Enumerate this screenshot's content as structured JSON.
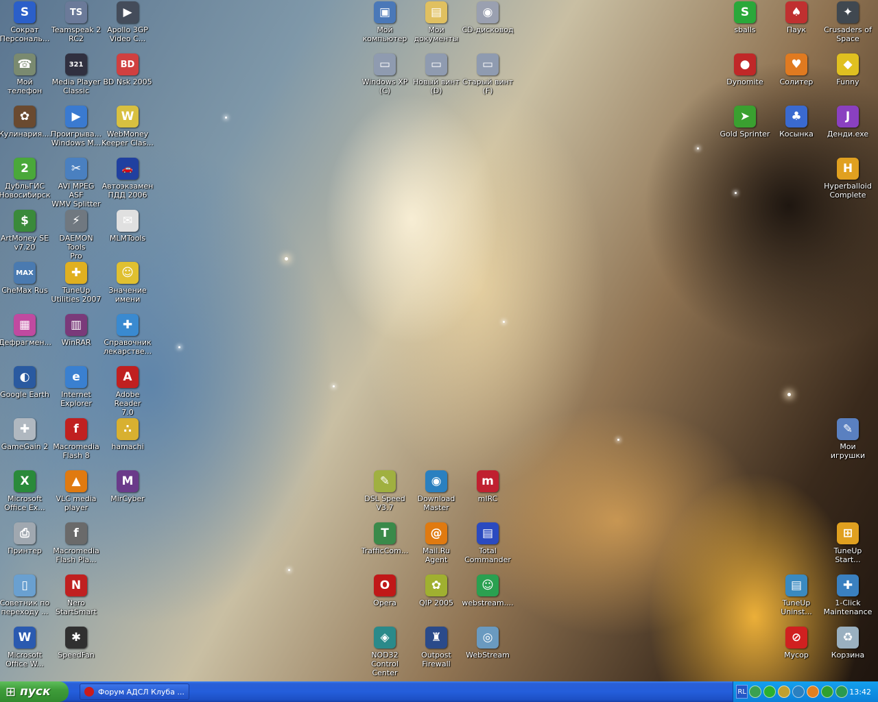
{
  "desktop": {
    "icons": [
      {
        "label": "Сократ\nПерсональ...",
        "color": "#2b5fc9",
        "glyph": "S"
      },
      {
        "label": "Teamspeak 2\nRC2",
        "color": "#6b7a99",
        "glyph": "TS"
      },
      {
        "label": "Apollo 3GP\nVideo C...",
        "color": "#444c5a",
        "glyph": "▶"
      },
      {
        "label": "Мой\nкомпьютер",
        "color": "#4a78b8",
        "glyph": "▣"
      },
      {
        "label": "Мои\nдокументы",
        "color": "#e0c060",
        "glyph": "▤"
      },
      {
        "label": "CD-дисковод",
        "color": "#9aa0b0",
        "glyph": "◉"
      },
      {
        "label": "sballs",
        "color": "#2aa83a",
        "glyph": "S"
      },
      {
        "label": "Паук",
        "color": "#c03030",
        "glyph": "♠"
      },
      {
        "label": "Crusaders of\nSpace",
        "color": "#404850",
        "glyph": "✦"
      },
      {
        "label": "Мой телефон",
        "color": "#7a8a70",
        "glyph": "☎"
      },
      {
        "label": "Media Player\nClassic",
        "color": "#303040",
        "glyph": "321"
      },
      {
        "label": "BD Nsk 2005",
        "color": "#d04040",
        "glyph": "BD"
      },
      {
        "label": "Windows XP\n(C)",
        "color": "#8f9bb0",
        "glyph": "▭"
      },
      {
        "label": "Новый винт\n(D)",
        "color": "#8f9bb0",
        "glyph": "▭"
      },
      {
        "label": "Старый винт\n(F)",
        "color": "#8f9bb0",
        "glyph": "▭"
      },
      {
        "label": "Dynomite",
        "color": "#c02828",
        "glyph": "●"
      },
      {
        "label": "Солитер",
        "color": "#e07a20",
        "glyph": "♥"
      },
      {
        "label": "Funny",
        "color": "#e0c020",
        "glyph": "◆"
      },
      {
        "label": "Кулинария....",
        "color": "#6a4a30",
        "glyph": "✿"
      },
      {
        "label": "Проигрыва...\nWindows M...",
        "color": "#3a7ad0",
        "glyph": "▶"
      },
      {
        "label": "WebMoney\nKeeper Clas...",
        "color": "#d8c040",
        "glyph": "W"
      },
      {
        "label": "Gold Sprinter",
        "color": "#3aa030",
        "glyph": "➤"
      },
      {
        "label": "Косынка",
        "color": "#3a6ad0",
        "glyph": "♣"
      },
      {
        "label": "Денди.exe",
        "color": "#8a40c0",
        "glyph": "J"
      },
      {
        "label": "ДубльГИС\nНовосибирск",
        "color": "#4aa83a",
        "glyph": "2"
      },
      {
        "label": "AVI MPEG ASF\nWMV Splitter",
        "color": "#4a80c0",
        "glyph": "✂"
      },
      {
        "label": "Автоэкзамен\nПДД 2006",
        "color": "#2040a0",
        "glyph": "🚗"
      },
      {
        "label": "Hyperballoid\nComplete",
        "color": "#e0a020",
        "glyph": "H"
      },
      {
        "label": "ArtMoney SE\nv7.20",
        "color": "#3a8a3a",
        "glyph": "$"
      },
      {
        "label": "DAEMON Tools\nPro",
        "color": "#707880",
        "glyph": "⚡"
      },
      {
        "label": "MLMTools",
        "color": "#e0e0e0",
        "glyph": "✉"
      },
      {
        "label": "CheMax Rus",
        "color": "#4a7ab0",
        "glyph": "MAX"
      },
      {
        "label": "TuneUp\nUtilities 2007",
        "color": "#e0b020",
        "glyph": "✚"
      },
      {
        "label": "Значение\nимени",
        "color": "#e0c030",
        "glyph": "☺"
      },
      {
        "label": "Дефрагмен...",
        "color": "#c04aa0",
        "glyph": "▦"
      },
      {
        "label": "WinRAR",
        "color": "#7a3a7a",
        "glyph": "▥"
      },
      {
        "label": "Справочник\nлекарстве...",
        "color": "#3a8ad0",
        "glyph": "✚"
      },
      {
        "label": "Google Earth",
        "color": "#2a5aa0",
        "glyph": "◐"
      },
      {
        "label": "Internet\nExplorer",
        "color": "#3a80d0",
        "glyph": "e"
      },
      {
        "label": "Adobe Reader\n7.0",
        "color": "#c02020",
        "glyph": "A"
      },
      {
        "label": "Мои игрушки",
        "color": "#5a80c0",
        "glyph": "✎"
      },
      {
        "label": "GameGain 2",
        "color": "#b0b8c0",
        "glyph": "✚"
      },
      {
        "label": "Macromedia\nFlash 8",
        "color": "#c02020",
        "glyph": "f"
      },
      {
        "label": "hamachi",
        "color": "#d8b030",
        "glyph": "∴"
      },
      {
        "label": "DSL Speed\nV3.7",
        "color": "#a0b040",
        "glyph": "✎"
      },
      {
        "label": "Download\nMaster",
        "color": "#2a80c0",
        "glyph": "◉"
      },
      {
        "label": "mIRC",
        "color": "#c02030",
        "glyph": "m"
      },
      {
        "label": "Microsoft\nOffice Ex...",
        "color": "#2a8a3a",
        "glyph": "X"
      },
      {
        "label": "VLC media\nplayer",
        "color": "#e07a10",
        "glyph": "▲"
      },
      {
        "label": "MirCyber",
        "color": "#6a3a8a",
        "glyph": "M"
      },
      {
        "label": "Принтер",
        "color": "#a0a8b0",
        "glyph": "⎙"
      },
      {
        "label": "Macromedia\nFlash Pla...",
        "color": "#6a6a6a",
        "glyph": "f"
      },
      {
        "label": "TrafficCom...",
        "color": "#3a8a4a",
        "glyph": "T"
      },
      {
        "label": "Mail.Ru Agent",
        "color": "#e07a10",
        "glyph": "@"
      },
      {
        "label": "Total\nCommander",
        "color": "#2a4ac0",
        "glyph": "▤"
      },
      {
        "label": "TuneUp\nStart...",
        "color": "#e0a020",
        "glyph": "⊞"
      },
      {
        "label": "Советник по\nпереходу ...",
        "color": "#6aa0d0",
        "glyph": "▯"
      },
      {
        "label": "Nero\nStartSmart",
        "color": "#c02020",
        "glyph": "N"
      },
      {
        "label": "Opera",
        "color": "#c01818",
        "glyph": "O"
      },
      {
        "label": "QIP 2005",
        "color": "#a0b030",
        "glyph": "✿"
      },
      {
        "label": "webstream....",
        "color": "#2aa050",
        "glyph": "☺"
      },
      {
        "label": "TuneUp\nUninst...",
        "color": "#3a8ac0",
        "glyph": "▤"
      },
      {
        "label": "1-Click\nMaintenance",
        "color": "#3a80c0",
        "glyph": "✚"
      },
      {
        "label": "Microsoft\nOffice W...",
        "color": "#2a5ab0",
        "glyph": "W"
      },
      {
        "label": "SpeedFan",
        "color": "#303030",
        "glyph": "✱"
      },
      {
        "label": "NOD32\nControl Center",
        "color": "#2a8a8a",
        "glyph": "◈"
      },
      {
        "label": "Outpost\nFirewall",
        "color": "#2a4a8a",
        "glyph": "♜"
      },
      {
        "label": "WebStream",
        "color": "#6a9ac0",
        "glyph": "◎"
      },
      {
        "label": "Мусор",
        "color": "#d02020",
        "glyph": "⊘"
      },
      {
        "label": "Корзина",
        "color": "#9ab0c0",
        "glyph": "♻"
      }
    ]
  },
  "taskbar": {
    "start_label": "пуск",
    "start_icon": "windows-logo-icon",
    "tasks": [
      {
        "label": "Форум АДСЛ Клуба ...",
        "icon": "opera-icon"
      }
    ],
    "tray": {
      "language": "RL",
      "icons": [
        "#3aa050",
        "#2ab030",
        "#c0a030",
        "#2a80c0",
        "#e08020",
        "#30a030",
        "#2a9a50"
      ],
      "clock": "13:42"
    }
  }
}
